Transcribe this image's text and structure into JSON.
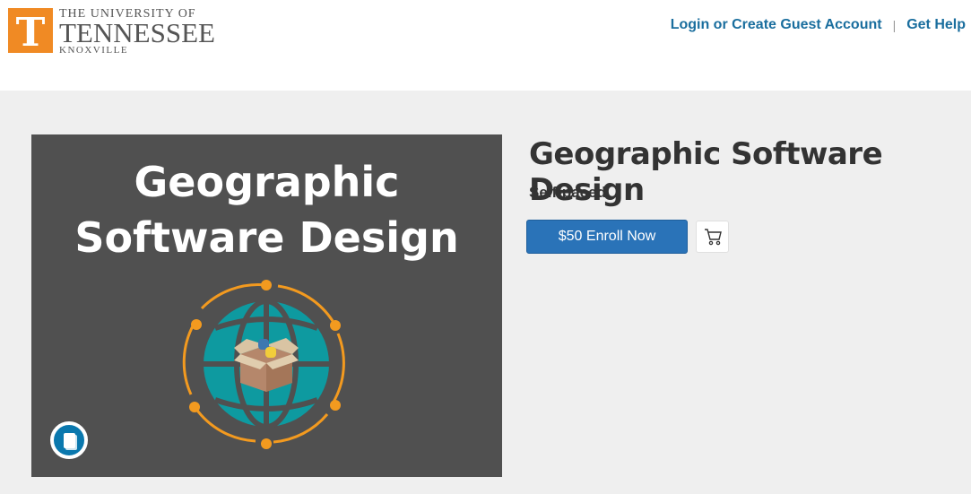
{
  "logo": {
    "letter": "T",
    "line1": "THE UNIVERSITY OF",
    "line2": "TENNESSEE",
    "line3": "KNOXVILLE"
  },
  "nav": {
    "login": "Login or Create Guest Account",
    "separator": "|",
    "help": "Get Help"
  },
  "course": {
    "image_title_line1": "Geographic",
    "image_title_line2": "Software Design",
    "title": "Geographic Software Design",
    "pace": "Self-paced",
    "enroll_label": "$50 Enroll Now"
  },
  "icons": {
    "cart": "cart-icon",
    "book": "book-icon",
    "globe": "globe-icon"
  },
  "colors": {
    "accent": "#2a73b8",
    "link": "#1a6e9e",
    "brand": "#f08a24",
    "teal": "#0e9aa0"
  }
}
